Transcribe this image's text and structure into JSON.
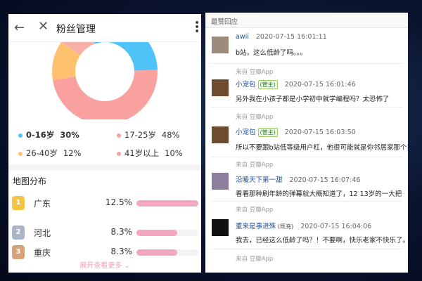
{
  "left": {
    "title": "粉丝管理",
    "age_legend": [
      {
        "label": "0-16岁",
        "percent": "30%",
        "color": "#4fc3f7",
        "value": 30,
        "bold": true
      },
      {
        "label": "17-25岁",
        "percent": "48%",
        "color": "#f8a19e",
        "value": 48,
        "bold": false
      },
      {
        "label": "26-40岁",
        "percent": "12%",
        "color": "#ffc16e",
        "value": 12,
        "bold": false
      },
      {
        "label": "41岁以上",
        "percent": "10%",
        "color": "#f8a19e",
        "value": 10,
        "bold": false
      }
    ],
    "region_title": "地图分布",
    "regions": [
      {
        "rank": "1",
        "name": "广东",
        "percent": "12.5%",
        "fill": 1.0,
        "badge_color": "#f5c542"
      },
      {
        "rank": "2",
        "name": "河北",
        "percent": "8.3%",
        "fill": 0.66,
        "badge_color": "#aab4c8"
      },
      {
        "rank": "3",
        "name": "重庆",
        "percent": "8.3%",
        "fill": 0.66,
        "badge_color": "#d9a17a"
      }
    ],
    "expand_label": "展开查看更多"
  },
  "right": {
    "heading": "最赞回应",
    "comments": [
      {
        "user": "awii",
        "badge": "",
        "time": "2020-07-15 16:01:11",
        "text": "b站，这么低龄了吗。。。",
        "source": "",
        "avatar_color": "#9c8c7c"
      },
      {
        "user": "小宠包",
        "badge": "(管主)",
        "time": "2020-07-15 16:01:46",
        "text": "另外我在小孩子都是小学初中就学编程吗？太恐怖了",
        "source": "来自 豆瓣App",
        "avatar_color": "#6e4a2e"
      },
      {
        "user": "小宠包",
        "badge": "(管主)",
        "time": "2020-07-15 16:03:50",
        "text": "所以不要跟b站低等级用户杠，他很可能就是你邻居家那个拔打的小孩子",
        "source": "来自 豆瓣App",
        "avatar_color": "#6e4a2e"
      },
      {
        "user": "沿暖天下第一甜",
        "badge": "",
        "time": "2020-07-15 16:07:46",
        "text": "看看那种刷年龄的弹幕就大概知道了，12 13岁的一大把",
        "source": "来自 豆瓣App",
        "avatar_color": "#8e7f9c"
      },
      {
        "user": "重来是事进殊",
        "badge": "(既充)",
        "time": "2020-07-15 16:04:06",
        "text": "我去，已经这么低龄了吗？！不要啊，快乐老家不快乐了。",
        "source": "来自 豆瓣App",
        "avatar_color": "#111111"
      }
    ],
    "footer_source": "来自 豆瓣App"
  }
}
